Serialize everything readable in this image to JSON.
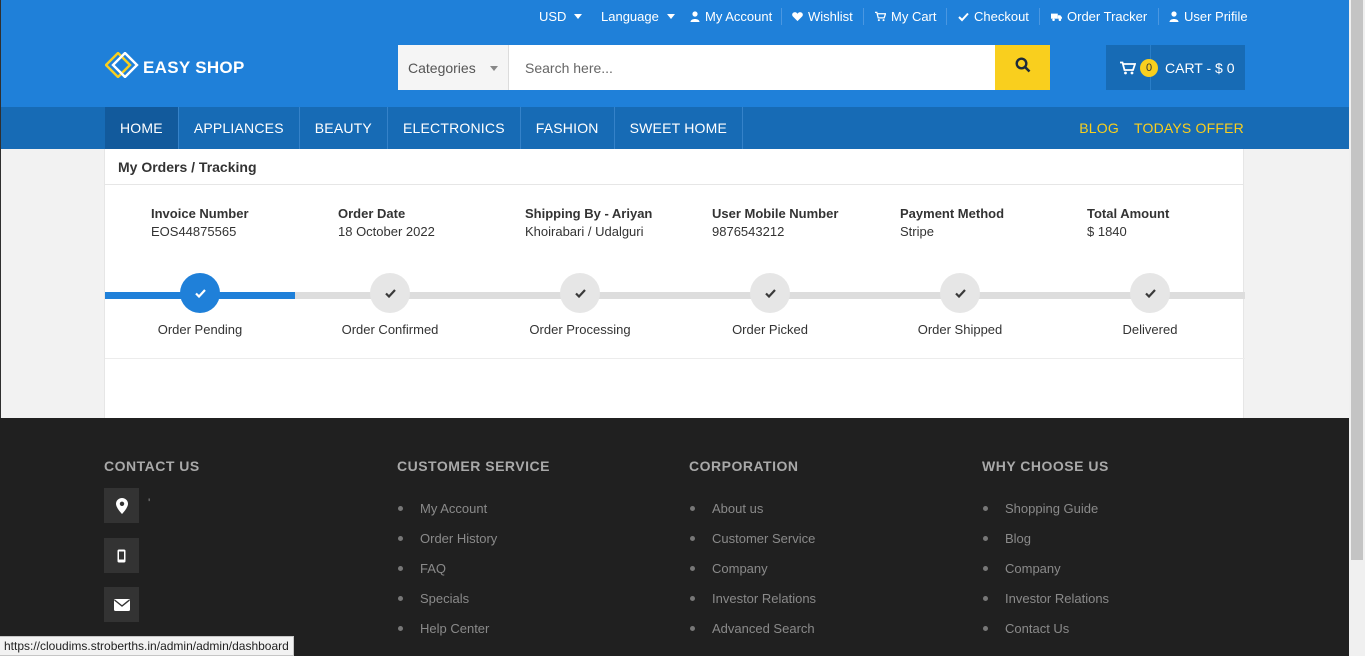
{
  "topbar": {
    "currency": "USD",
    "language": "Language",
    "my_account": "My Account",
    "wishlist": "Wishlist",
    "my_cart": "My Cart",
    "checkout": "Checkout",
    "order_tracker": "Order Tracker",
    "user_profile": "User Prifile"
  },
  "header": {
    "logo_text": "EASY SHOP",
    "categories_label": "Categories",
    "search_placeholder": "Search here...",
    "cart_count": "0",
    "cart_label": "CART - $ 0"
  },
  "nav": {
    "items": [
      {
        "label": "HOME",
        "active": true
      },
      {
        "label": "APPLIANCES"
      },
      {
        "label": "BEAUTY"
      },
      {
        "label": "ELECTRONICS"
      },
      {
        "label": "FASHION"
      },
      {
        "label": "SWEET HOME"
      }
    ],
    "right": [
      "BLOG",
      "TODAYS OFFER"
    ]
  },
  "order": {
    "title": "My Orders / Tracking",
    "fields": [
      {
        "label": "Invoice Number",
        "value": "EOS44875565"
      },
      {
        "label": "Order Date",
        "value": "18 October 2022"
      },
      {
        "label": "Shipping By - Ariyan",
        "value": "Khoirabari / Udalguri"
      },
      {
        "label": "User Mobile Number",
        "value": "9876543212"
      },
      {
        "label": "Payment Method",
        "value": "Stripe"
      },
      {
        "label": "Total Amount",
        "value": "$ 1840"
      }
    ],
    "steps": [
      "Order Pending",
      "Order Confirmed",
      "Order Processing",
      "Order Picked",
      "Order Shipped",
      "Delivered"
    ],
    "current_step": 1
  },
  "footer": {
    "contact_title": "CONTACT US",
    "contact_text": "'",
    "customer_service": {
      "title": "CUSTOMER SERVICE",
      "links": [
        "My Account",
        "Order History",
        "FAQ",
        "Specials",
        "Help Center"
      ]
    },
    "corporation": {
      "title": "CORPORATION",
      "links": [
        "About us",
        "Customer Service",
        "Company",
        "Investor Relations",
        "Advanced Search"
      ]
    },
    "why_choose_us": {
      "title": "WHY CHOOSE US",
      "links": [
        "Shopping Guide",
        "Blog",
        "Company",
        "Investor Relations",
        "Contact Us"
      ]
    }
  },
  "status_url": "https://cloudims.stroberths.in/admin/admin/dashboard",
  "colors": {
    "brand_blue": "#1f80d9",
    "nav_blue": "#176bb5",
    "accent_yellow": "#f9cf1e",
    "footer_bg": "#202020"
  }
}
